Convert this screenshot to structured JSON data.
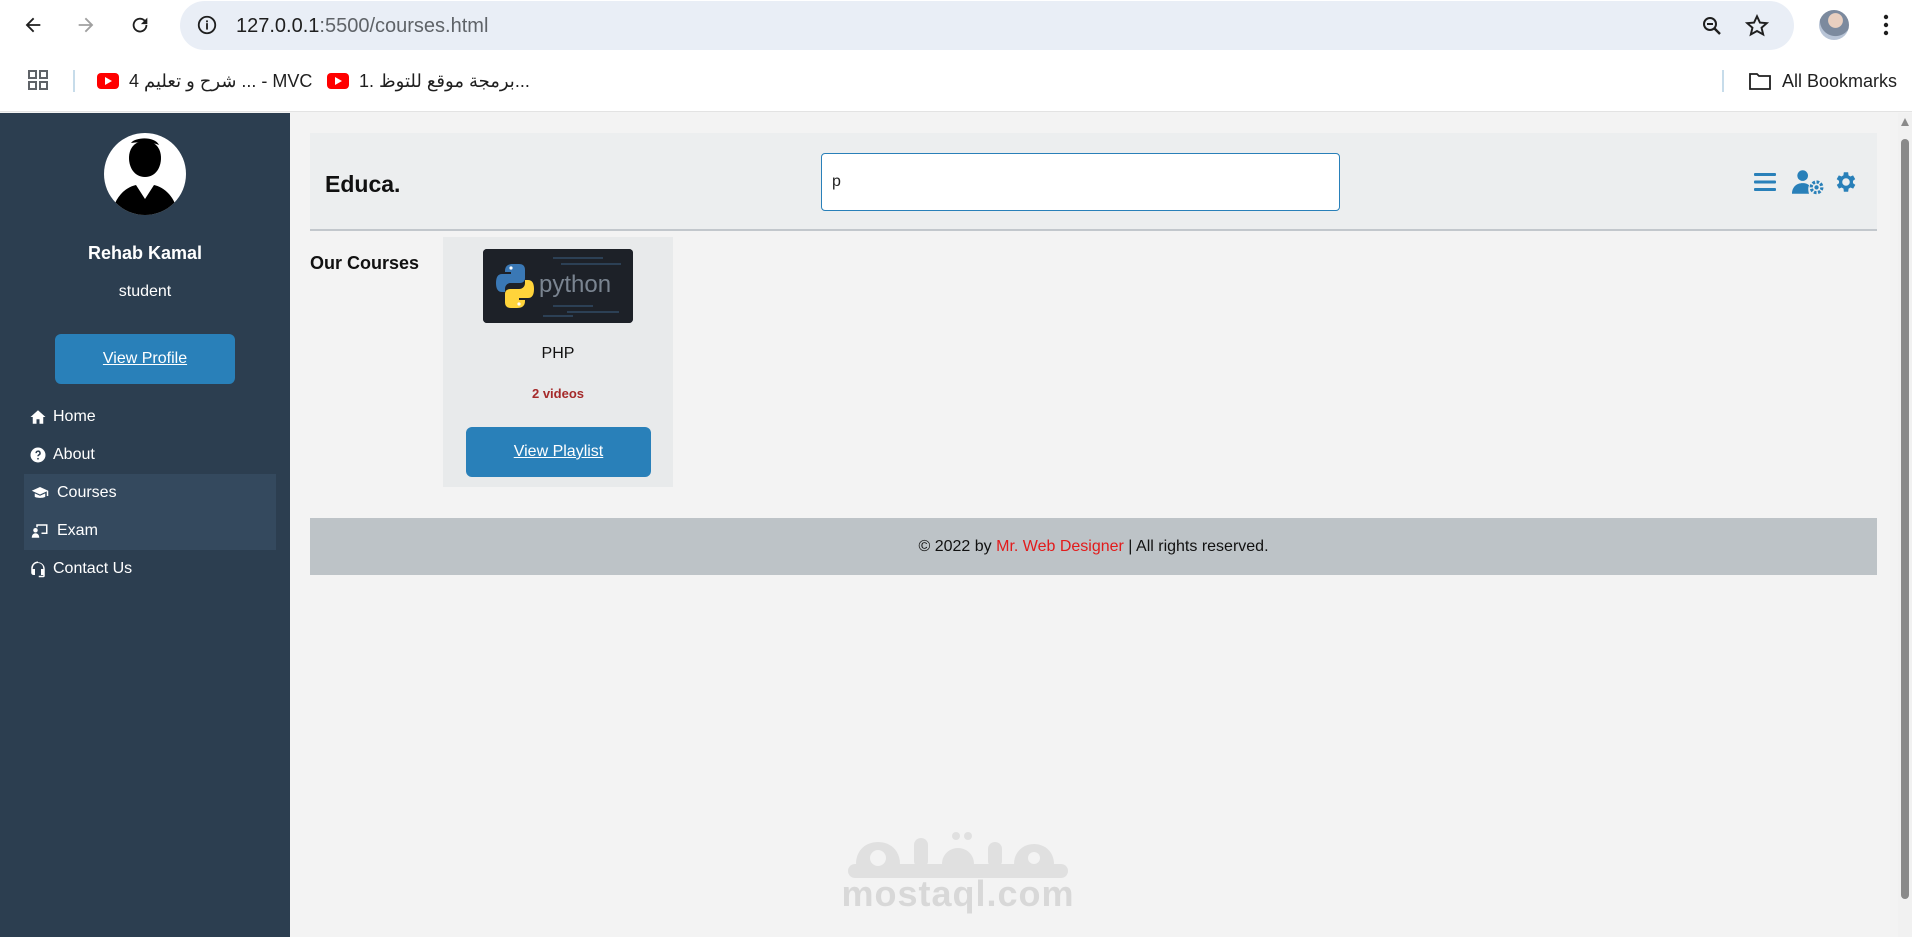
{
  "browser": {
    "url_host": "127.0.0.1",
    "url_port_path": ":5500/courses.html",
    "bookmarks": [
      {
        "label": "شرح و تعليم 4 ... - MVC",
        "icon": "youtube-icon"
      },
      {
        "label": "1. برمجة موقع للتوظ...",
        "icon": "youtube-icon"
      }
    ],
    "all_bookmarks_label": "All Bookmarks"
  },
  "sidebar": {
    "name": "Rehab Kamal",
    "role": "student",
    "view_profile_label": "View Profile",
    "nav": [
      {
        "label": "Home",
        "icon": "home-icon",
        "active": false
      },
      {
        "label": "About",
        "icon": "question-circle-icon",
        "active": false
      },
      {
        "label": "Courses",
        "icon": "graduation-cap-icon",
        "active": true
      },
      {
        "label": "Exam",
        "icon": "chalkboard-user-icon",
        "active": true
      },
      {
        "label": "Contact Us",
        "icon": "headset-icon",
        "active": false
      }
    ]
  },
  "header": {
    "logo": "Educa.",
    "search_value": "p",
    "icons": [
      "menu-icon",
      "user-gear-icon",
      "settings-gear-icon"
    ]
  },
  "main": {
    "section_title": "Our Courses",
    "courses": [
      {
        "title": "PHP",
        "meta": "2 videos",
        "button_label": "View Playlist",
        "thumbnail_text": "python"
      }
    ]
  },
  "footer": {
    "prefix": "© 2022 by ",
    "brand": "Mr. Web Designer",
    "suffix": " | All rights reserved."
  },
  "watermark": {
    "text": "mostaql.com"
  },
  "colors": {
    "sidebar_bg": "#2c3e50",
    "accent": "#2980b9",
    "meta_red": "#a52a2a",
    "footer_brand": "#e21b1b"
  }
}
